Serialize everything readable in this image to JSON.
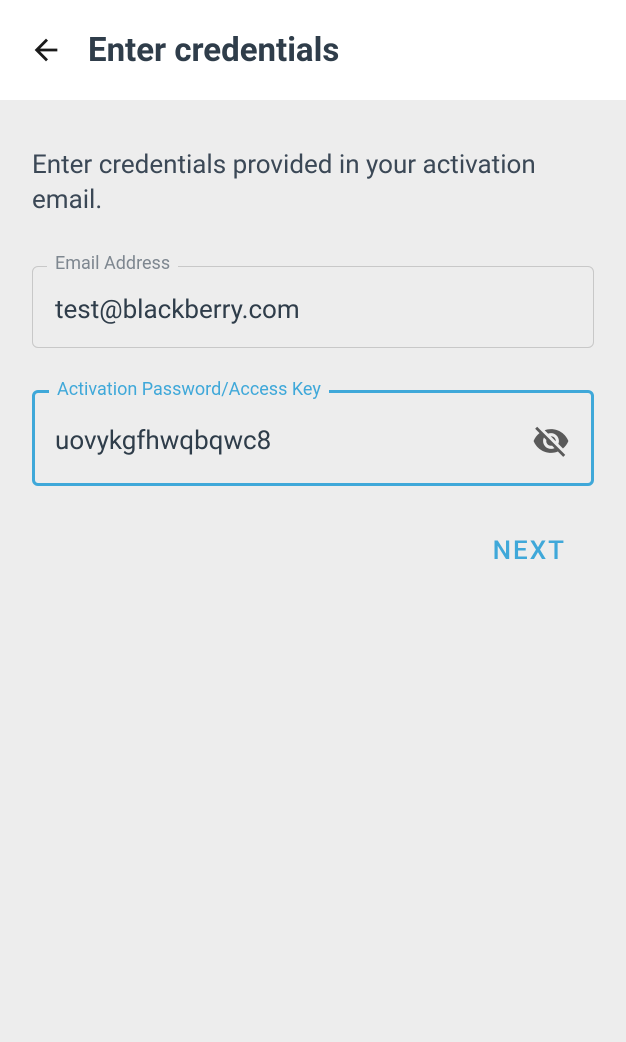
{
  "header": {
    "title": "Enter credentials"
  },
  "instructions": "Enter credentials provided in your activation email.",
  "fields": {
    "email": {
      "label": "Email Address",
      "value": "test@blackberry.com"
    },
    "password": {
      "label": "Activation Password/Access Key",
      "value": "uovykgfhwqbqwc8"
    }
  },
  "next_label": "NEXT"
}
